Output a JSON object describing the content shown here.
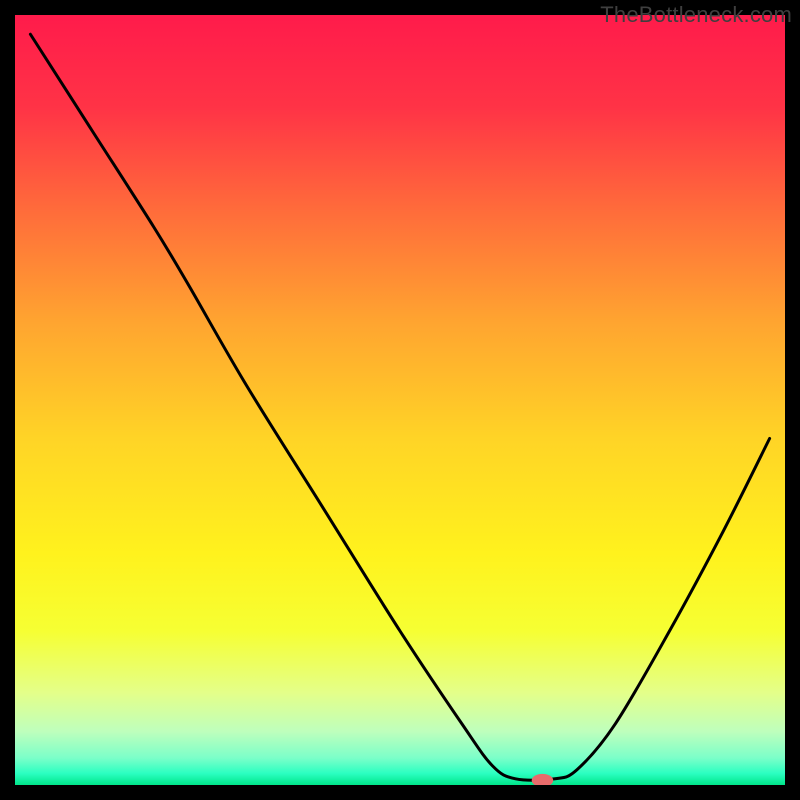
{
  "watermark": "TheBottleneck.com",
  "chart_data": {
    "type": "line",
    "title": "",
    "xlabel": "",
    "ylabel": "",
    "xlim": [
      0,
      100
    ],
    "ylim": [
      0,
      100
    ],
    "background_gradient_stops": [
      {
        "offset": 0.0,
        "color": "#ff1b4b"
      },
      {
        "offset": 0.12,
        "color": "#ff3346"
      },
      {
        "offset": 0.25,
        "color": "#ff6a3b"
      },
      {
        "offset": 0.4,
        "color": "#ffa530"
      },
      {
        "offset": 0.55,
        "color": "#ffd426"
      },
      {
        "offset": 0.7,
        "color": "#fff21d"
      },
      {
        "offset": 0.8,
        "color": "#f6ff33"
      },
      {
        "offset": 0.88,
        "color": "#e4ff89"
      },
      {
        "offset": 0.93,
        "color": "#bfffbc"
      },
      {
        "offset": 0.965,
        "color": "#7bffc9"
      },
      {
        "offset": 0.985,
        "color": "#2bffc1"
      },
      {
        "offset": 1.0,
        "color": "#00e58a"
      }
    ],
    "series": [
      {
        "name": "bottleneck-curve",
        "color": "#000000",
        "points": [
          {
            "x": 2.0,
            "y": 97.5
          },
          {
            "x": 10.0,
            "y": 85.0
          },
          {
            "x": 18.0,
            "y": 72.5
          },
          {
            "x": 22.5,
            "y": 65.0
          },
          {
            "x": 30.0,
            "y": 52.0
          },
          {
            "x": 40.0,
            "y": 36.0
          },
          {
            "x": 50.0,
            "y": 20.0
          },
          {
            "x": 58.0,
            "y": 8.0
          },
          {
            "x": 62.0,
            "y": 2.5
          },
          {
            "x": 65.0,
            "y": 0.8
          },
          {
            "x": 70.0,
            "y": 0.8
          },
          {
            "x": 73.0,
            "y": 2.0
          },
          {
            "x": 78.0,
            "y": 8.0
          },
          {
            "x": 85.0,
            "y": 20.0
          },
          {
            "x": 92.0,
            "y": 33.0
          },
          {
            "x": 98.0,
            "y": 45.0
          }
        ]
      }
    ],
    "marker": {
      "name": "selected-point",
      "x": 68.5,
      "y": 0.6,
      "rx": 1.4,
      "ry": 0.85,
      "color": "#e86b6b"
    },
    "annotations": []
  }
}
